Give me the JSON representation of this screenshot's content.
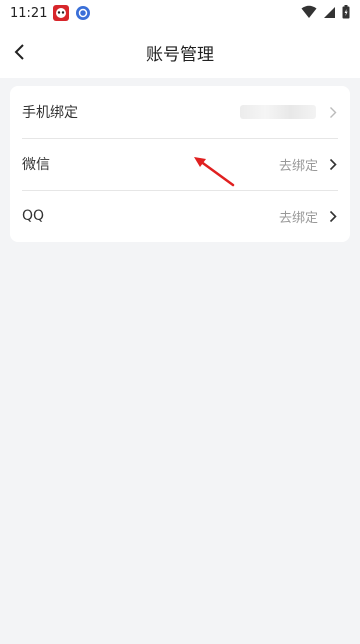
{
  "status_bar": {
    "time": "11:21",
    "icons": [
      "panda-app-icon",
      "blue-app-icon",
      "wifi-icon",
      "signal-icon",
      "battery-icon"
    ]
  },
  "header": {
    "title": "账号管理",
    "back_icon": "chevron-left-icon"
  },
  "account_rows": [
    {
      "label": "手机绑定",
      "value": "",
      "value_masked": true
    },
    {
      "label": "微信",
      "value": "去绑定"
    },
    {
      "label": "QQ",
      "value": "去绑定"
    }
  ],
  "colors": {
    "background": "#f3f4f6",
    "card": "#ffffff",
    "annotation": "#e02020"
  }
}
